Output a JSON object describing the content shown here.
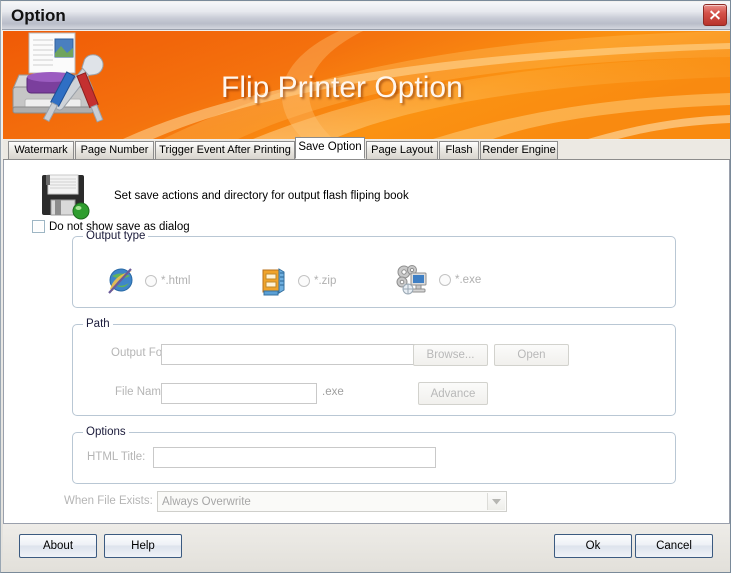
{
  "window": {
    "title": "Option",
    "close_icon": "close-icon"
  },
  "banner": {
    "title": "Flip Printer Option",
    "icon": "printer-tools-icon"
  },
  "tabs": [
    {
      "label": "Watermark",
      "active": false
    },
    {
      "label": "Page Number",
      "active": false
    },
    {
      "label": "Trigger Event After Printing",
      "active": false
    },
    {
      "label": "Save Option",
      "active": true
    },
    {
      "label": "Page Layout",
      "active": false
    },
    {
      "label": "Flash",
      "active": false
    },
    {
      "label": "Render Engine",
      "active": false
    }
  ],
  "header": {
    "icon": "floppy-disk-save-icon",
    "description": "Set save actions and directory for output flash fliping book"
  },
  "dialog_checkbox": {
    "label": "Do not show save as dialog",
    "checked": false
  },
  "output_type": {
    "title": "Output type",
    "options": [
      {
        "label": "*.html",
        "icon": "globe-html-icon",
        "selected": false
      },
      {
        "label": "*.zip",
        "icon": "zip-archive-icon",
        "selected": false
      },
      {
        "label": "*.exe",
        "icon": "gears-monitor-exe-icon",
        "selected": false
      }
    ]
  },
  "path": {
    "title": "Path",
    "output_folder_label": "Output Folder:",
    "output_folder_value": "",
    "output_folder_placeholder": "",
    "browse_button": "Browse...",
    "open_button": "Open",
    "file_name_label": "File Name:",
    "file_name_value": "",
    "file_name_placeholder": "",
    "file_extension": ".exe",
    "advance_button": "Advance"
  },
  "options": {
    "title": "Options",
    "html_title_label": "HTML Title:",
    "html_title_value": "",
    "html_title_placeholder": ""
  },
  "when_file_exists": {
    "label": "When File Exists:",
    "value": "Always Overwrite",
    "choices": [
      "Always Overwrite"
    ]
  },
  "footer": {
    "about_button": "About",
    "help_button": "Help",
    "ok_button": "Ok",
    "cancel_button": "Cancel"
  },
  "colors": {
    "banner_orange": "#f2670d",
    "banner_orange_light": "#ff9b1e",
    "close_red": "#c4382f",
    "group_border": "#b9c7d4",
    "button_border_blue": "#3b5a80"
  }
}
